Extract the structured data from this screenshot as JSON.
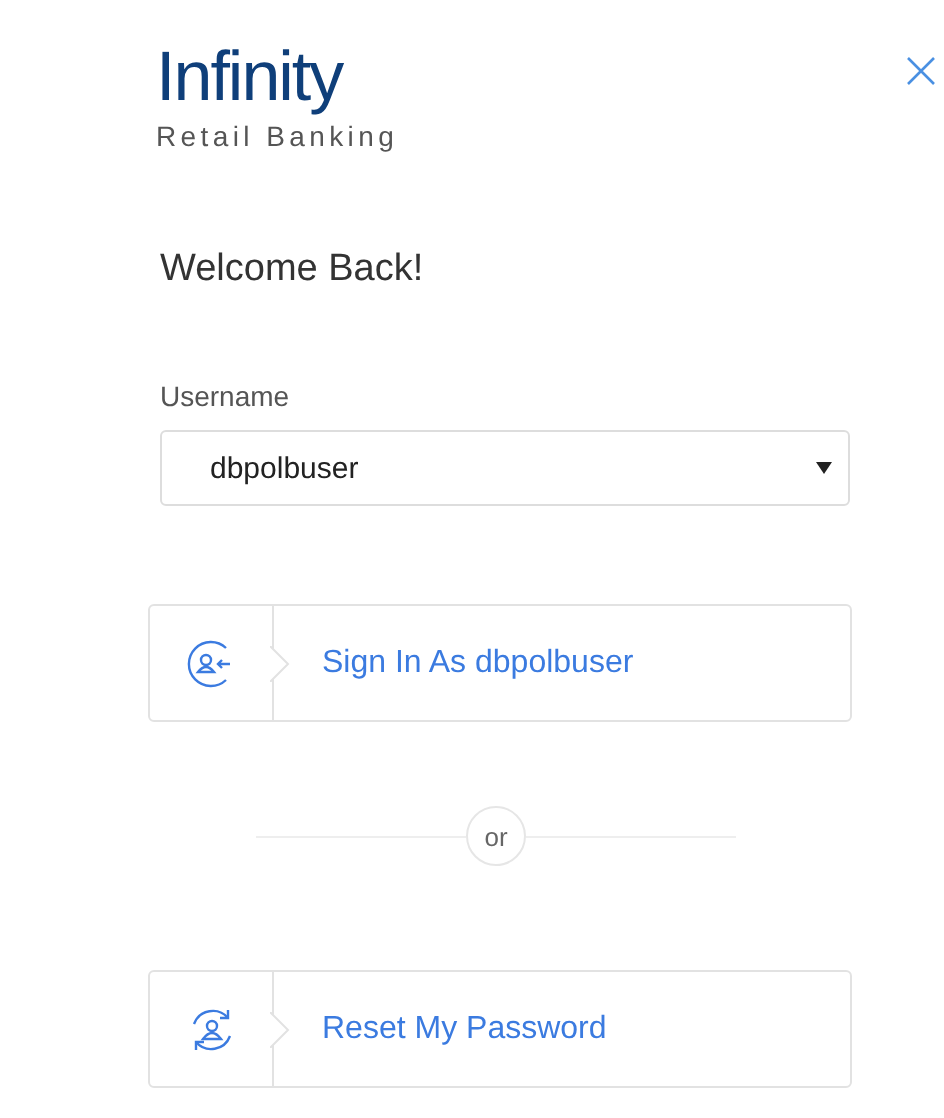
{
  "logo": {
    "name": "Infinity",
    "tagline": "Retail Banking"
  },
  "heading": "Welcome Back!",
  "username": {
    "label": "Username",
    "value": "dbpolbuser"
  },
  "actions": [
    {
      "kind": "sign-in",
      "label": "Sign In As dbpolbuser"
    },
    {
      "kind": "reset",
      "label": "Reset My Password"
    }
  ],
  "separator": "or"
}
